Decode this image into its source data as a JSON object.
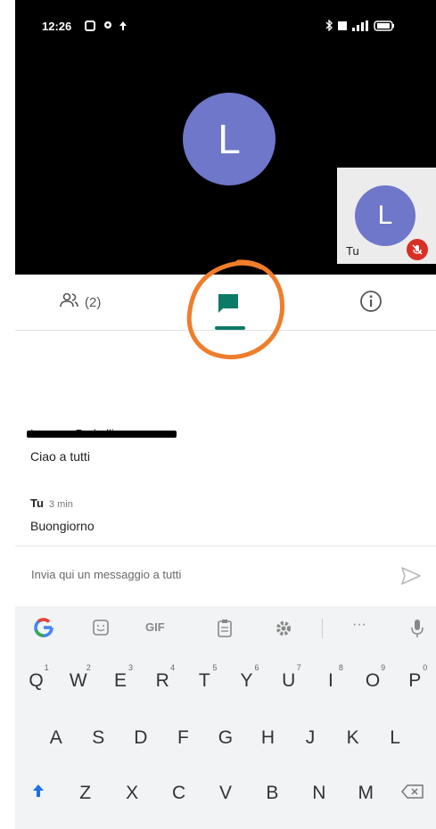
{
  "status_bar": {
    "time": "12:26"
  },
  "video": {
    "main_avatar_initial": "L",
    "self_tile": {
      "avatar_initial": "L",
      "label": "Tu"
    }
  },
  "tabs": {
    "people_count": "(2)"
  },
  "messages": [
    {
      "sender": "Lorenzo Pedrelli",
      "time": "3 min",
      "text": "Ciao a tutti"
    },
    {
      "sender": "Tu",
      "time": "3 min",
      "text": "Buongiorno"
    }
  ],
  "compose": {
    "placeholder": "Invia qui un messaggio a tutti"
  },
  "keyboard": {
    "toolbar": [
      "G",
      "sticker",
      "GIF",
      "clipboard",
      "settings",
      "...",
      "mic"
    ],
    "gif_label": "GIF",
    "more_label": "···",
    "row1": [
      {
        "k": "Q",
        "n": "1"
      },
      {
        "k": "W",
        "n": "2"
      },
      {
        "k": "E",
        "n": "3"
      },
      {
        "k": "R",
        "n": "4"
      },
      {
        "k": "T",
        "n": "5"
      },
      {
        "k": "Y",
        "n": "6"
      },
      {
        "k": "U",
        "n": "7"
      },
      {
        "k": "I",
        "n": "8"
      },
      {
        "k": "O",
        "n": "9"
      },
      {
        "k": "P",
        "n": "0"
      }
    ],
    "row2": [
      "A",
      "S",
      "D",
      "F",
      "G",
      "H",
      "J",
      "K",
      "L"
    ],
    "row3": [
      "Z",
      "X",
      "C",
      "V",
      "B",
      "N",
      "M"
    ]
  },
  "colors": {
    "avatar": "#6e77c9",
    "chat_tab": "#0b7a67",
    "mute": "#d93025",
    "annotation": "#f07d2b"
  }
}
